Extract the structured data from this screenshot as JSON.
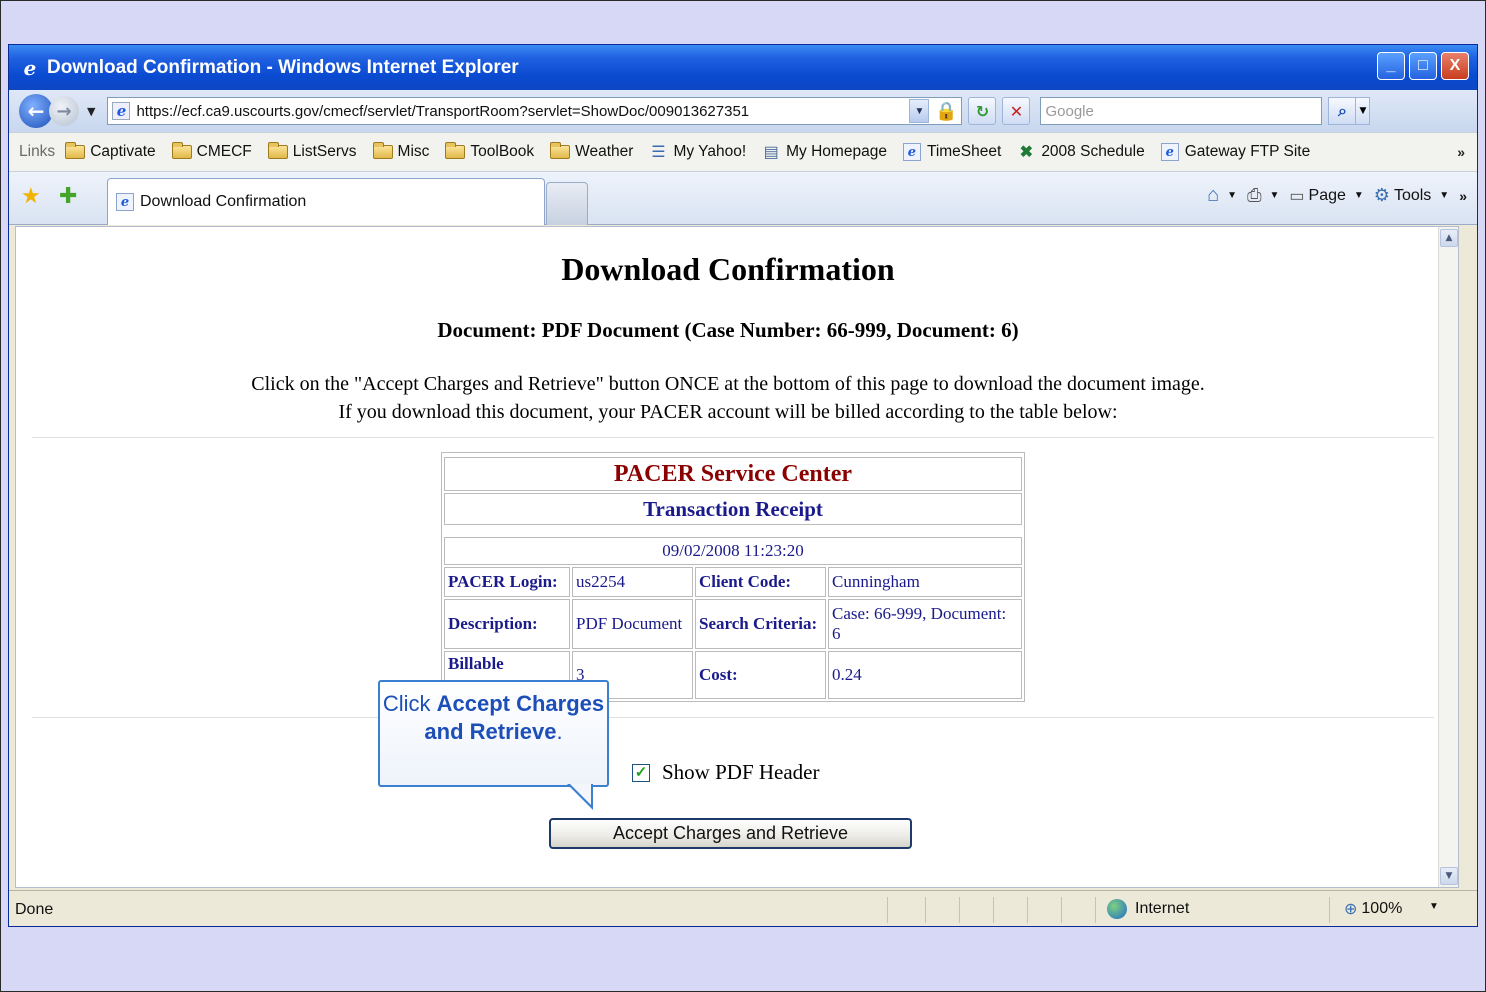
{
  "window": {
    "title": "Download Confirmation - Windows Internet Explorer",
    "buttons": [
      "_",
      "□",
      "X"
    ]
  },
  "address_bar": {
    "url": "https://ecf.ca9.uscourts.gov/cmecf/servlet/TransportRoom?servlet=ShowDoc/009013627351",
    "search_placeholder": "Google"
  },
  "links_bar": {
    "label": "Links",
    "items": [
      {
        "label": "Captivate",
        "icon": "folder-icon"
      },
      {
        "label": "CMECF",
        "icon": "folder-icon"
      },
      {
        "label": "ListServs",
        "icon": "folder-icon"
      },
      {
        "label": "Misc",
        "icon": "folder-icon"
      },
      {
        "label": "ToolBook",
        "icon": "folder-icon"
      },
      {
        "label": "Weather",
        "icon": "folder-icon"
      },
      {
        "label": "My Yahoo!",
        "icon": "yahoo-icon"
      },
      {
        "label": "My Homepage",
        "icon": "page-icon"
      },
      {
        "label": "TimeSheet",
        "icon": "ie-icon"
      },
      {
        "label": "2008 Schedule",
        "icon": "excel-icon"
      },
      {
        "label": "Gateway FTP Site",
        "icon": "ie-icon"
      }
    ]
  },
  "tabs": {
    "active_label": "Download Confirmation",
    "command_bar": {
      "page": "Page",
      "tools": "Tools"
    }
  },
  "page": {
    "title": "Download Confirmation",
    "document_line": "Document: PDF Document (Case Number: 66-999, Document: 6)",
    "instruction_1": "Click on the \"Accept Charges and Retrieve\" button ONCE at the bottom of this page to download the document image.",
    "instruction_2": "If you download this document, your PACER account will be billed according to the table below:",
    "receipt": {
      "service_center": "PACER Service Center",
      "transaction_receipt": "Transaction Receipt",
      "datetime": "09/02/2008 11:23:20",
      "login_label": "PACER Login:",
      "login_value": "us2254",
      "client_code_label": "Client Code:",
      "client_code_value": "Cunningham",
      "description_label": "Description:",
      "description_value": "PDF Document",
      "search_criteria_label": "Search Criteria:",
      "search_criteria_value": "Case: 66-999, Document: 6",
      "billable_label": "Billable",
      "billable_value": "3",
      "cost_label": "Cost:",
      "cost_value": "0.24"
    },
    "show_pdf_header_label": "Show PDF Header",
    "show_pdf_header_checked": true,
    "accept_button": "Accept Charges and Retrieve"
  },
  "callout": {
    "prefix": "Click ",
    "bold": "Accept Charges and Retrieve",
    "suffix": "."
  },
  "status_bar": {
    "status": "Done",
    "zone": "Internet",
    "zoom": "100%"
  },
  "colors": {
    "titlebar": "#0a4ad0",
    "service_center": "#8b0000",
    "receipt_text": "#1a1a8a",
    "callout_text": "#1d4fb8"
  }
}
